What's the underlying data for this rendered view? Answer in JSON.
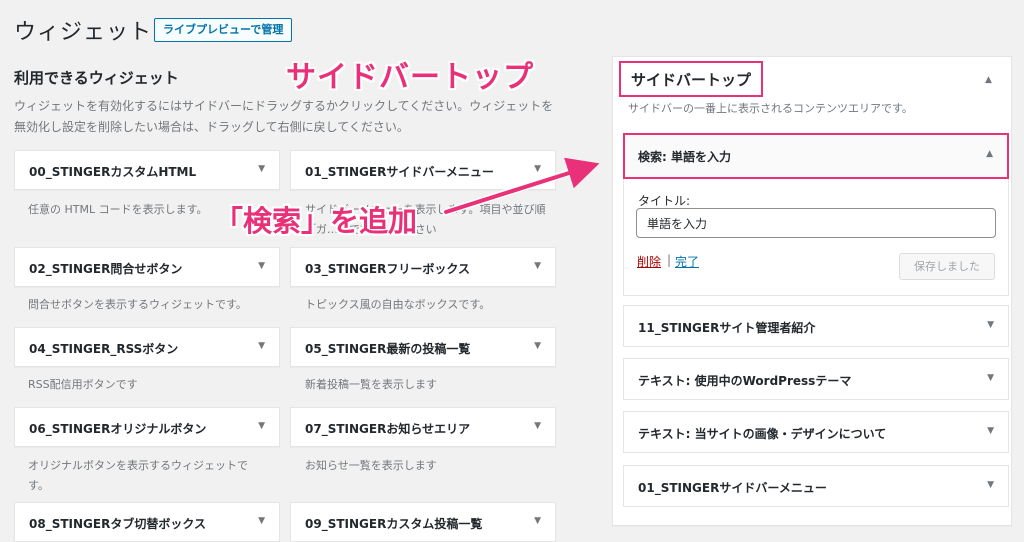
{
  "header": {
    "title": "ウィジェット",
    "live_preview_button": "ライブプレビューで管理"
  },
  "available": {
    "title": "利用できるウィジェット",
    "description": "ウィジェットを有効化するにはサイドバーにドラッグするかクリックしてください。ウィジェットを無効化し設定を削除したい場合は、ドラッグして右側に戻してください。",
    "widgets": [
      {
        "title": "00_STINGERカスタムHTML",
        "desc": "任意の HTML コードを表示します。"
      },
      {
        "title": "01_STINGERサイドバーメニュー",
        "desc": "サイドバーメニューを表示します。項目や並び順「ガ…」で設定して下さい"
      },
      {
        "title": "02_STINGER問合せボタン",
        "desc": "問合せボタンを表示するウィジェットです。"
      },
      {
        "title": "03_STINGERフリーボックス",
        "desc": "トピックス風の自由なボックスです。"
      },
      {
        "title": "04_STINGER_RSSボタン",
        "desc": "RSS配信用ボタンです"
      },
      {
        "title": "05_STINGER最新の投稿一覧",
        "desc": "新着投稿一覧を表示します"
      },
      {
        "title": "06_STINGERオリジナルボタン",
        "desc": "オリジナルボタンを表示するウィジェットです。"
      },
      {
        "title": "07_STINGERお知らせエリア",
        "desc": "お知らせ一覧を表示します"
      },
      {
        "title": "08_STINGERタブ切替ボックス",
        "desc": ""
      },
      {
        "title": "09_STINGERカスタム投稿一覧",
        "desc": ""
      }
    ]
  },
  "annotations": {
    "sidebar_top": "サイドバートップ",
    "add_search": "「検索」を追加"
  },
  "sidebar": {
    "title": "サイドバートップ",
    "description": "サイドバーの一番上に表示されるコンテンツエリアです。",
    "search_widget": {
      "title": "検索: 単語を入力",
      "title_label": "タイトル:",
      "title_value": "単語を入力",
      "delete_label": "削除",
      "separator": "|",
      "done_label": "完了",
      "saved_label": "保存しました"
    },
    "widgets": [
      {
        "title": "11_STINGERサイト管理者紹介"
      },
      {
        "title": "テキスト: 使用中のWordPressテーマ"
      },
      {
        "title": "テキスト: 当サイトの画像・デザインについて"
      },
      {
        "title": "01_STINGERサイドバーメニュー"
      }
    ]
  },
  "colors": {
    "accent": "#e9317a",
    "link": "#0073aa",
    "delete": "#aa0000"
  },
  "icons": {
    "widget_toggle": "triangle-down-icon",
    "sidebar_toggle": "triangle-up-icon"
  }
}
